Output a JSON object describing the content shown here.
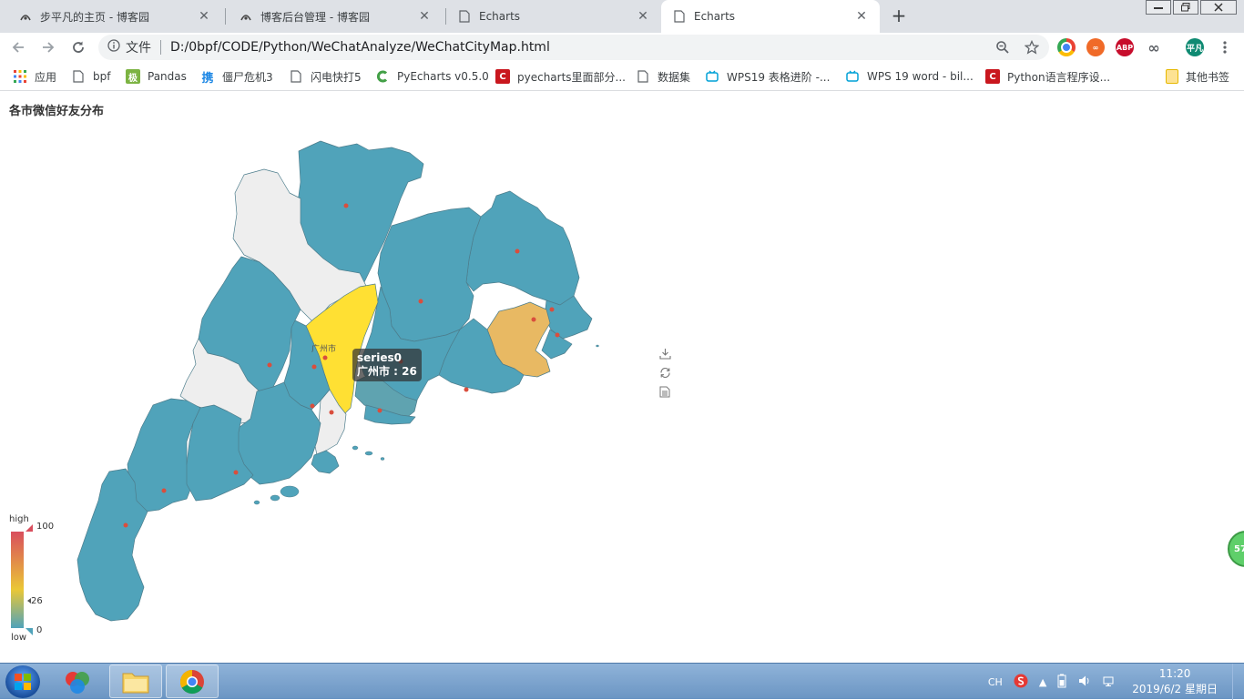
{
  "browser": {
    "tabs": [
      {
        "title": "步平凡的主页 - 博客园",
        "icon": "cnblogs-icon",
        "active": false
      },
      {
        "title": "博客后台管理 - 博客园",
        "icon": "cnblogs-icon",
        "active": false
      },
      {
        "title": "Echarts",
        "icon": "page-icon",
        "active": false
      },
      {
        "title": "Echarts",
        "icon": "page-icon",
        "active": true
      }
    ],
    "new_tab_label": "+",
    "close_glyph": "✕",
    "address": {
      "security_label": "文件",
      "url": "D:/0bpf/CODE/Python/WeChatAnalyze/WeChatCityMap.html"
    },
    "profile_label": "平凡",
    "bookmarks": [
      {
        "label": "应用",
        "icon": "apps-grid-icon"
      },
      {
        "label": "bpf",
        "icon": "page-icon"
      },
      {
        "label": "Pandas",
        "icon": "pandas-icon"
      },
      {
        "label": "僵尸危机3",
        "icon": "game-icon"
      },
      {
        "label": "闪电快打5",
        "icon": "page-icon"
      },
      {
        "label": "PyEcharts v0.5.0",
        "icon": "pyecharts-icon"
      },
      {
        "label": "pyecharts里面部分...",
        "icon": "csdn-icon"
      },
      {
        "label": "数据集",
        "icon": "page-icon"
      },
      {
        "label": "WPS19 表格进阶 -...",
        "icon": "bilibili-icon"
      },
      {
        "label": "WPS 19 word - bil...",
        "icon": "bilibili-icon"
      },
      {
        "label": "Python语言程序设...",
        "icon": "csdn-icon"
      },
      {
        "label": "其他书签",
        "icon": "folder-icon"
      }
    ]
  },
  "chart_data": {
    "type": "map",
    "title": "各市微信好友分布",
    "region": "广东",
    "series_name": "series0",
    "highlighted": {
      "name": "广州市",
      "value": 26
    },
    "tooltip": {
      "series": "series0",
      "text": "广州市 : 26"
    },
    "visual_map": {
      "min": 0,
      "max": 100,
      "high_label": "high",
      "low_label": "low",
      "indicator_value": 26,
      "min_label": "0",
      "max_label": "100",
      "indicator_label": "26"
    },
    "colors": {
      "low": "#50a3ba",
      "mid": "#eac736",
      "high": "#d94e5d",
      "empty": "#eeeeee",
      "emphasis": "#ffe033",
      "point": "#d94e3d"
    }
  },
  "taskbar": {
    "clock_time": "11:20",
    "clock_date": "2019/6/2 星期日",
    "ime_label": "CH",
    "side_badge": "57"
  }
}
